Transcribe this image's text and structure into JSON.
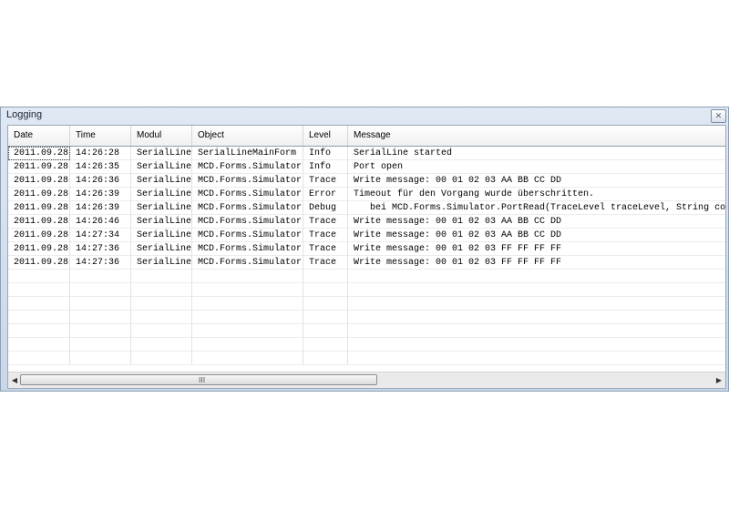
{
  "window": {
    "title": "Logging",
    "close_icon": "✕"
  },
  "table": {
    "columns": [
      "Date",
      "Time",
      "Modul",
      "Object",
      "Level",
      "Message"
    ],
    "rows": [
      [
        "2011.09.28",
        "14:26:28",
        "SerialLine",
        "SerialLineMainForm",
        "Info",
        "SerialLine started"
      ],
      [
        "2011.09.28",
        "14:26:35",
        "SerialLine",
        "MCD.Forms.Simulator",
        "Info",
        "Port open"
      ],
      [
        "2011.09.28",
        "14:26:36",
        "SerialLine",
        "MCD.Forms.Simulator",
        "Trace",
        "Write message: 00 01 02 03 AA BB CC DD"
      ],
      [
        "2011.09.28",
        "14:26:39",
        "SerialLine",
        "MCD.Forms.Simulator",
        "Error",
        "Timeout für den Vorgang wurde überschritten."
      ],
      [
        "2011.09.28",
        "14:26:39",
        "SerialLine",
        "MCD.Forms.Simulator",
        "Debug",
        "   bei MCD.Forms.Simulator.PortRead(TraceLevel traceLevel, String comm"
      ],
      [
        "2011.09.28",
        "14:26:46",
        "SerialLine",
        "MCD.Forms.Simulator",
        "Trace",
        "Write message: 00 01 02 03 AA BB CC DD"
      ],
      [
        "2011.09.28",
        "14:27:34",
        "SerialLine",
        "MCD.Forms.Simulator",
        "Trace",
        "Write message: 00 01 02 03 AA BB CC DD"
      ],
      [
        "2011.09.28",
        "14:27:36",
        "SerialLine",
        "MCD.Forms.Simulator",
        "Trace",
        "Write message: 00 01 02 03 FF FF FF FF"
      ],
      [
        "2011.09.28",
        "14:27:36",
        "SerialLine",
        "MCD.Forms.Simulator",
        "Trace",
        "Write message: 00 01 02 03 FF FF FF FF"
      ]
    ],
    "empty_rows": 7
  },
  "scrollbar": {
    "left_icon": "◀",
    "right_icon": "▶",
    "grip": "III",
    "position": 0
  }
}
